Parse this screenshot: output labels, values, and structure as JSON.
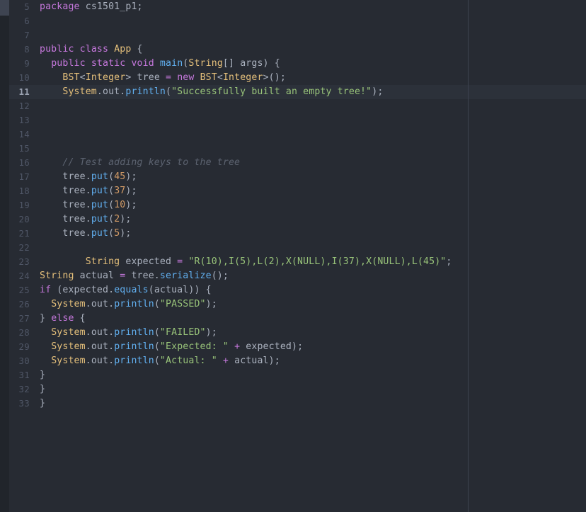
{
  "editor": {
    "theme_name": "one-dark",
    "background": "#272b33",
    "active_line_background": "#2c313a",
    "gutter_color": "#4f5666",
    "active_gutter_color": "#9aa2b1",
    "ruler_color": "#3d4350",
    "scrollbar_track": "#21252b",
    "scrollbar_thumb": "#3e4451",
    "active_line_number": 11,
    "first_visible_line": 5,
    "last_visible_line": 33,
    "language": "java",
    "token_colors": {
      "keyword": "#c678dd",
      "type": "#e5c07b",
      "method": "#61afef",
      "string": "#98c379",
      "number": "#d19a66",
      "comment": "#5c6370",
      "plain": "#abb2bf",
      "operator": "#c678dd"
    }
  },
  "lines": [
    {
      "number": "5",
      "tokens": [
        {
          "t": "package",
          "c": "keyword"
        },
        {
          "t": " cs1501_p1;",
          "c": "plain"
        }
      ]
    },
    {
      "number": "6",
      "tokens": []
    },
    {
      "number": "7",
      "tokens": []
    },
    {
      "number": "8",
      "tokens": [
        {
          "t": "public",
          "c": "keyword"
        },
        {
          "t": " ",
          "c": "plain"
        },
        {
          "t": "class",
          "c": "keyword"
        },
        {
          "t": " ",
          "c": "plain"
        },
        {
          "t": "App",
          "c": "type"
        },
        {
          "t": " {",
          "c": "punct"
        }
      ]
    },
    {
      "number": "9",
      "tokens": [
        {
          "t": "  ",
          "c": "plain"
        },
        {
          "t": "public",
          "c": "keyword"
        },
        {
          "t": " ",
          "c": "plain"
        },
        {
          "t": "static",
          "c": "keyword"
        },
        {
          "t": " ",
          "c": "plain"
        },
        {
          "t": "void",
          "c": "keyword"
        },
        {
          "t": " ",
          "c": "plain"
        },
        {
          "t": "main",
          "c": "method"
        },
        {
          "t": "(",
          "c": "punct"
        },
        {
          "t": "String",
          "c": "type"
        },
        {
          "t": "[] args) {",
          "c": "plain"
        }
      ]
    },
    {
      "number": "10",
      "tokens": [
        {
          "t": "    ",
          "c": "plain"
        },
        {
          "t": "BST",
          "c": "type"
        },
        {
          "t": "<",
          "c": "punct"
        },
        {
          "t": "Integer",
          "c": "type"
        },
        {
          "t": "> tree ",
          "c": "plain"
        },
        {
          "t": "=",
          "c": "operator"
        },
        {
          "t": " ",
          "c": "plain"
        },
        {
          "t": "new",
          "c": "keyword"
        },
        {
          "t": " ",
          "c": "plain"
        },
        {
          "t": "BST",
          "c": "type"
        },
        {
          "t": "<",
          "c": "punct"
        },
        {
          "t": "Integer",
          "c": "type"
        },
        {
          "t": ">();",
          "c": "punct"
        }
      ]
    },
    {
      "number": "11",
      "active": true,
      "tokens": [
        {
          "t": "    ",
          "c": "plain"
        },
        {
          "t": "System",
          "c": "type"
        },
        {
          "t": ".out.",
          "c": "plain"
        },
        {
          "t": "println",
          "c": "method"
        },
        {
          "t": "(",
          "c": "punct"
        },
        {
          "t": "\"Successfully built an empty tree!\"",
          "c": "string"
        },
        {
          "t": ");",
          "c": "punct"
        }
      ]
    },
    {
      "number": "12",
      "tokens": []
    },
    {
      "number": "13",
      "tokens": []
    },
    {
      "number": "14",
      "tokens": []
    },
    {
      "number": "15",
      "tokens": []
    },
    {
      "number": "16",
      "tokens": [
        {
          "t": "    ",
          "c": "plain"
        },
        {
          "t": "// Test adding keys to the tree",
          "c": "comment"
        }
      ]
    },
    {
      "number": "17",
      "tokens": [
        {
          "t": "    tree.",
          "c": "plain"
        },
        {
          "t": "put",
          "c": "method"
        },
        {
          "t": "(",
          "c": "punct"
        },
        {
          "t": "45",
          "c": "number"
        },
        {
          "t": ");",
          "c": "punct"
        }
      ]
    },
    {
      "number": "18",
      "tokens": [
        {
          "t": "    tree.",
          "c": "plain"
        },
        {
          "t": "put",
          "c": "method"
        },
        {
          "t": "(",
          "c": "punct"
        },
        {
          "t": "37",
          "c": "number"
        },
        {
          "t": ");",
          "c": "punct"
        }
      ]
    },
    {
      "number": "19",
      "tokens": [
        {
          "t": "    tree.",
          "c": "plain"
        },
        {
          "t": "put",
          "c": "method"
        },
        {
          "t": "(",
          "c": "punct"
        },
        {
          "t": "10",
          "c": "number"
        },
        {
          "t": ");",
          "c": "punct"
        }
      ]
    },
    {
      "number": "20",
      "tokens": [
        {
          "t": "    tree.",
          "c": "plain"
        },
        {
          "t": "put",
          "c": "method"
        },
        {
          "t": "(",
          "c": "punct"
        },
        {
          "t": "2",
          "c": "number"
        },
        {
          "t": ");",
          "c": "punct"
        }
      ]
    },
    {
      "number": "21",
      "tokens": [
        {
          "t": "    tree.",
          "c": "plain"
        },
        {
          "t": "put",
          "c": "method"
        },
        {
          "t": "(",
          "c": "punct"
        },
        {
          "t": "5",
          "c": "number"
        },
        {
          "t": ");",
          "c": "punct"
        }
      ]
    },
    {
      "number": "22",
      "tokens": []
    },
    {
      "number": "23",
      "tokens": [
        {
          "t": "        ",
          "c": "plain"
        },
        {
          "t": "String",
          "c": "type"
        },
        {
          "t": " expected ",
          "c": "plain"
        },
        {
          "t": "=",
          "c": "operator"
        },
        {
          "t": " ",
          "c": "plain"
        },
        {
          "t": "\"R(10),I(5),L(2),X(NULL),I(37),X(NULL),L(45)\"",
          "c": "string"
        },
        {
          "t": ";",
          "c": "punct"
        }
      ]
    },
    {
      "number": "24",
      "tokens": [
        {
          "t": "String",
          "c": "type"
        },
        {
          "t": " actual ",
          "c": "plain"
        },
        {
          "t": "=",
          "c": "operator"
        },
        {
          "t": " tree.",
          "c": "plain"
        },
        {
          "t": "serialize",
          "c": "method"
        },
        {
          "t": "();",
          "c": "punct"
        }
      ]
    },
    {
      "number": "25",
      "tokens": [
        {
          "t": "if",
          "c": "keyword"
        },
        {
          "t": " (expected.",
          "c": "plain"
        },
        {
          "t": "equals",
          "c": "method"
        },
        {
          "t": "(actual)) {",
          "c": "plain"
        }
      ]
    },
    {
      "number": "26",
      "tokens": [
        {
          "t": "  ",
          "c": "plain"
        },
        {
          "t": "System",
          "c": "type"
        },
        {
          "t": ".out.",
          "c": "plain"
        },
        {
          "t": "println",
          "c": "method"
        },
        {
          "t": "(",
          "c": "punct"
        },
        {
          "t": "\"PASSED\"",
          "c": "string"
        },
        {
          "t": ");",
          "c": "punct"
        }
      ]
    },
    {
      "number": "27",
      "tokens": [
        {
          "t": "} ",
          "c": "punct"
        },
        {
          "t": "else",
          "c": "keyword"
        },
        {
          "t": " {",
          "c": "punct"
        }
      ]
    },
    {
      "number": "28",
      "tokens": [
        {
          "t": "  ",
          "c": "plain"
        },
        {
          "t": "System",
          "c": "type"
        },
        {
          "t": ".out.",
          "c": "plain"
        },
        {
          "t": "println",
          "c": "method"
        },
        {
          "t": "(",
          "c": "punct"
        },
        {
          "t": "\"FAILED\"",
          "c": "string"
        },
        {
          "t": ");",
          "c": "punct"
        }
      ]
    },
    {
      "number": "29",
      "tokens": [
        {
          "t": "  ",
          "c": "plain"
        },
        {
          "t": "System",
          "c": "type"
        },
        {
          "t": ".out.",
          "c": "plain"
        },
        {
          "t": "println",
          "c": "method"
        },
        {
          "t": "(",
          "c": "punct"
        },
        {
          "t": "\"Expected: \"",
          "c": "string"
        },
        {
          "t": " ",
          "c": "plain"
        },
        {
          "t": "+",
          "c": "operator"
        },
        {
          "t": " expected);",
          "c": "plain"
        }
      ]
    },
    {
      "number": "30",
      "tokens": [
        {
          "t": "  ",
          "c": "plain"
        },
        {
          "t": "System",
          "c": "type"
        },
        {
          "t": ".out.",
          "c": "plain"
        },
        {
          "t": "println",
          "c": "method"
        },
        {
          "t": "(",
          "c": "punct"
        },
        {
          "t": "\"Actual: \"",
          "c": "string"
        },
        {
          "t": " ",
          "c": "plain"
        },
        {
          "t": "+",
          "c": "operator"
        },
        {
          "t": " actual);",
          "c": "plain"
        }
      ]
    },
    {
      "number": "31",
      "tokens": [
        {
          "t": "}",
          "c": "punct"
        }
      ]
    },
    {
      "number": "32",
      "tokens": [
        {
          "t": "}",
          "c": "punct"
        }
      ]
    },
    {
      "number": "33",
      "tokens": [
        {
          "t": "}",
          "c": "punct"
        }
      ]
    }
  ]
}
